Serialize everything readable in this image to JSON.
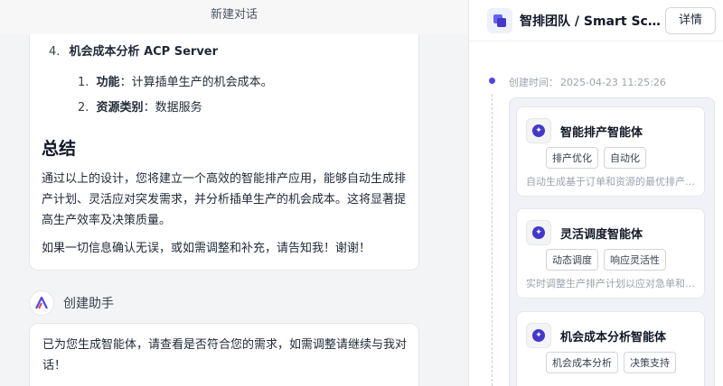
{
  "left": {
    "topbar_title": "新建对话",
    "section4": {
      "num": "4.",
      "title": "机会成本分析 ACP Server",
      "sub": [
        {
          "num": "1.",
          "label": "功能",
          "sep": "：",
          "text": "计算插单生产的机会成本。"
        },
        {
          "num": "2.",
          "label": "资源类别",
          "sep": "：",
          "text": "数据服务"
        }
      ]
    },
    "summary_heading": "总结",
    "summary_para": "通过以上的设计，您将建立一个高效的智能排产应用，能够自动生成排产计划、灵活应对突发需求，并分析插单生产的机会成本。这将显著提高生产效率及决策质量。",
    "closing_para": "如果一切信息确认无误，或如需调整和补充，请告知我！谢谢！",
    "assistant_name": "创建助手",
    "reply_text": "已为您生成智能体，请查看是否符合您的需求，如需调整请继续与我对话！"
  },
  "right": {
    "team_title": "智排团队 / Smart Scheduling",
    "details_label": "详情",
    "created_label": "创建时间：",
    "created_time": "2025-04-23 11:25:26",
    "agents": [
      {
        "name": "智能排产智能体",
        "tags": [
          "排产优化",
          "自动化"
        ],
        "desc": "自动生成基于订单和资源的最优排产计划"
      },
      {
        "name": "灵活调度智能体",
        "tags": [
          "动态调度",
          "响应灵活性"
        ],
        "desc": "实时调整生产排产计划以应对急单和变化"
      },
      {
        "name": "机会成本分析智能体",
        "tags": [
          "机会成本分析",
          "决策支持"
        ],
        "desc": ""
      }
    ]
  },
  "colors": {
    "accent": "#4f46e5",
    "accent_dark": "#4338ca",
    "muted_text": "#9ca3af"
  },
  "icons": {
    "team": "team-stack-icon",
    "agent": "sparkle-icon",
    "assistant": "assistant-logo-icon",
    "timeline": "timeline-dot-icon"
  }
}
